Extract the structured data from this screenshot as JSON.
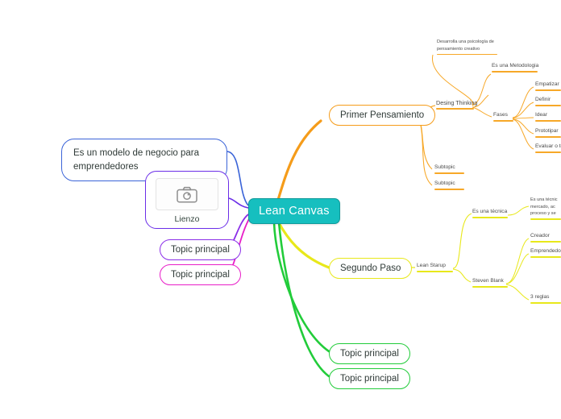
{
  "app": {
    "title": "Lean Canvas",
    "background": "#ffffff"
  },
  "colors": {
    "root_fill": "#16bfbf",
    "root_text": "#ffffff",
    "orange": "#f59c1a",
    "orange_line": "#f7a828",
    "blue": "#3b64d8",
    "purple": "#6b2ee8",
    "magenta": "#e81ec8",
    "yellow": "#e8e81a",
    "green": "#22cc3a",
    "green_dark": "#1fae36"
  },
  "root": {
    "label": "Lean Canvas"
  },
  "branches": {
    "primer_pensamiento": {
      "label": "Primer Pensamiento",
      "color": "#f59c1a",
      "children": [
        {
          "label": "Desing Thinking",
          "children": [
            {
              "label": "Desarrolla una psicología de pensamiento creativo"
            },
            {
              "label": "Es una Metodologia"
            },
            {
              "label": "Fases",
              "children": [
                {
                  "label": "Empatizar"
                },
                {
                  "label": "Definir"
                },
                {
                  "label": "Idear"
                },
                {
                  "label": "Prototipar"
                },
                {
                  "label": "Evaluar o te"
                }
              ]
            }
          ]
        },
        {
          "label": "Subtopic"
        },
        {
          "label": "Subtopic"
        }
      ]
    },
    "segundo_paso": {
      "label": "Segundo Paso",
      "color": "#e8e81a",
      "children": [
        {
          "label": "Lean Starup",
          "children": [
            {
              "label": "Es una técnica",
              "children": [
                {
                  "label": "Es una técnic mercado, ac proceso y se"
                }
              ]
            },
            {
              "label": "Steven Blank",
              "children": [
                {
                  "label": "Creador"
                },
                {
                  "label": "Emprendedor,"
                },
                {
                  "label": "3 reglas"
                }
              ]
            }
          ]
        }
      ]
    },
    "modelo_negocio": {
      "label": "Es un modelo de negocio para emprendedores",
      "color": "#3b64d8"
    },
    "lienzo": {
      "label": "Lienzo",
      "icon": "camera-icon",
      "color": "#6b2ee8"
    },
    "topic_purple": {
      "label": "Topic principal",
      "color": "#8b2ee8"
    },
    "topic_magenta": {
      "label": "Topic principal",
      "color": "#e81ec8"
    },
    "topic_green_1": {
      "label": "Topic principal",
      "color": "#22cc3a"
    },
    "topic_green_2": {
      "label": "Topic principal",
      "color": "#22cc3a"
    }
  }
}
